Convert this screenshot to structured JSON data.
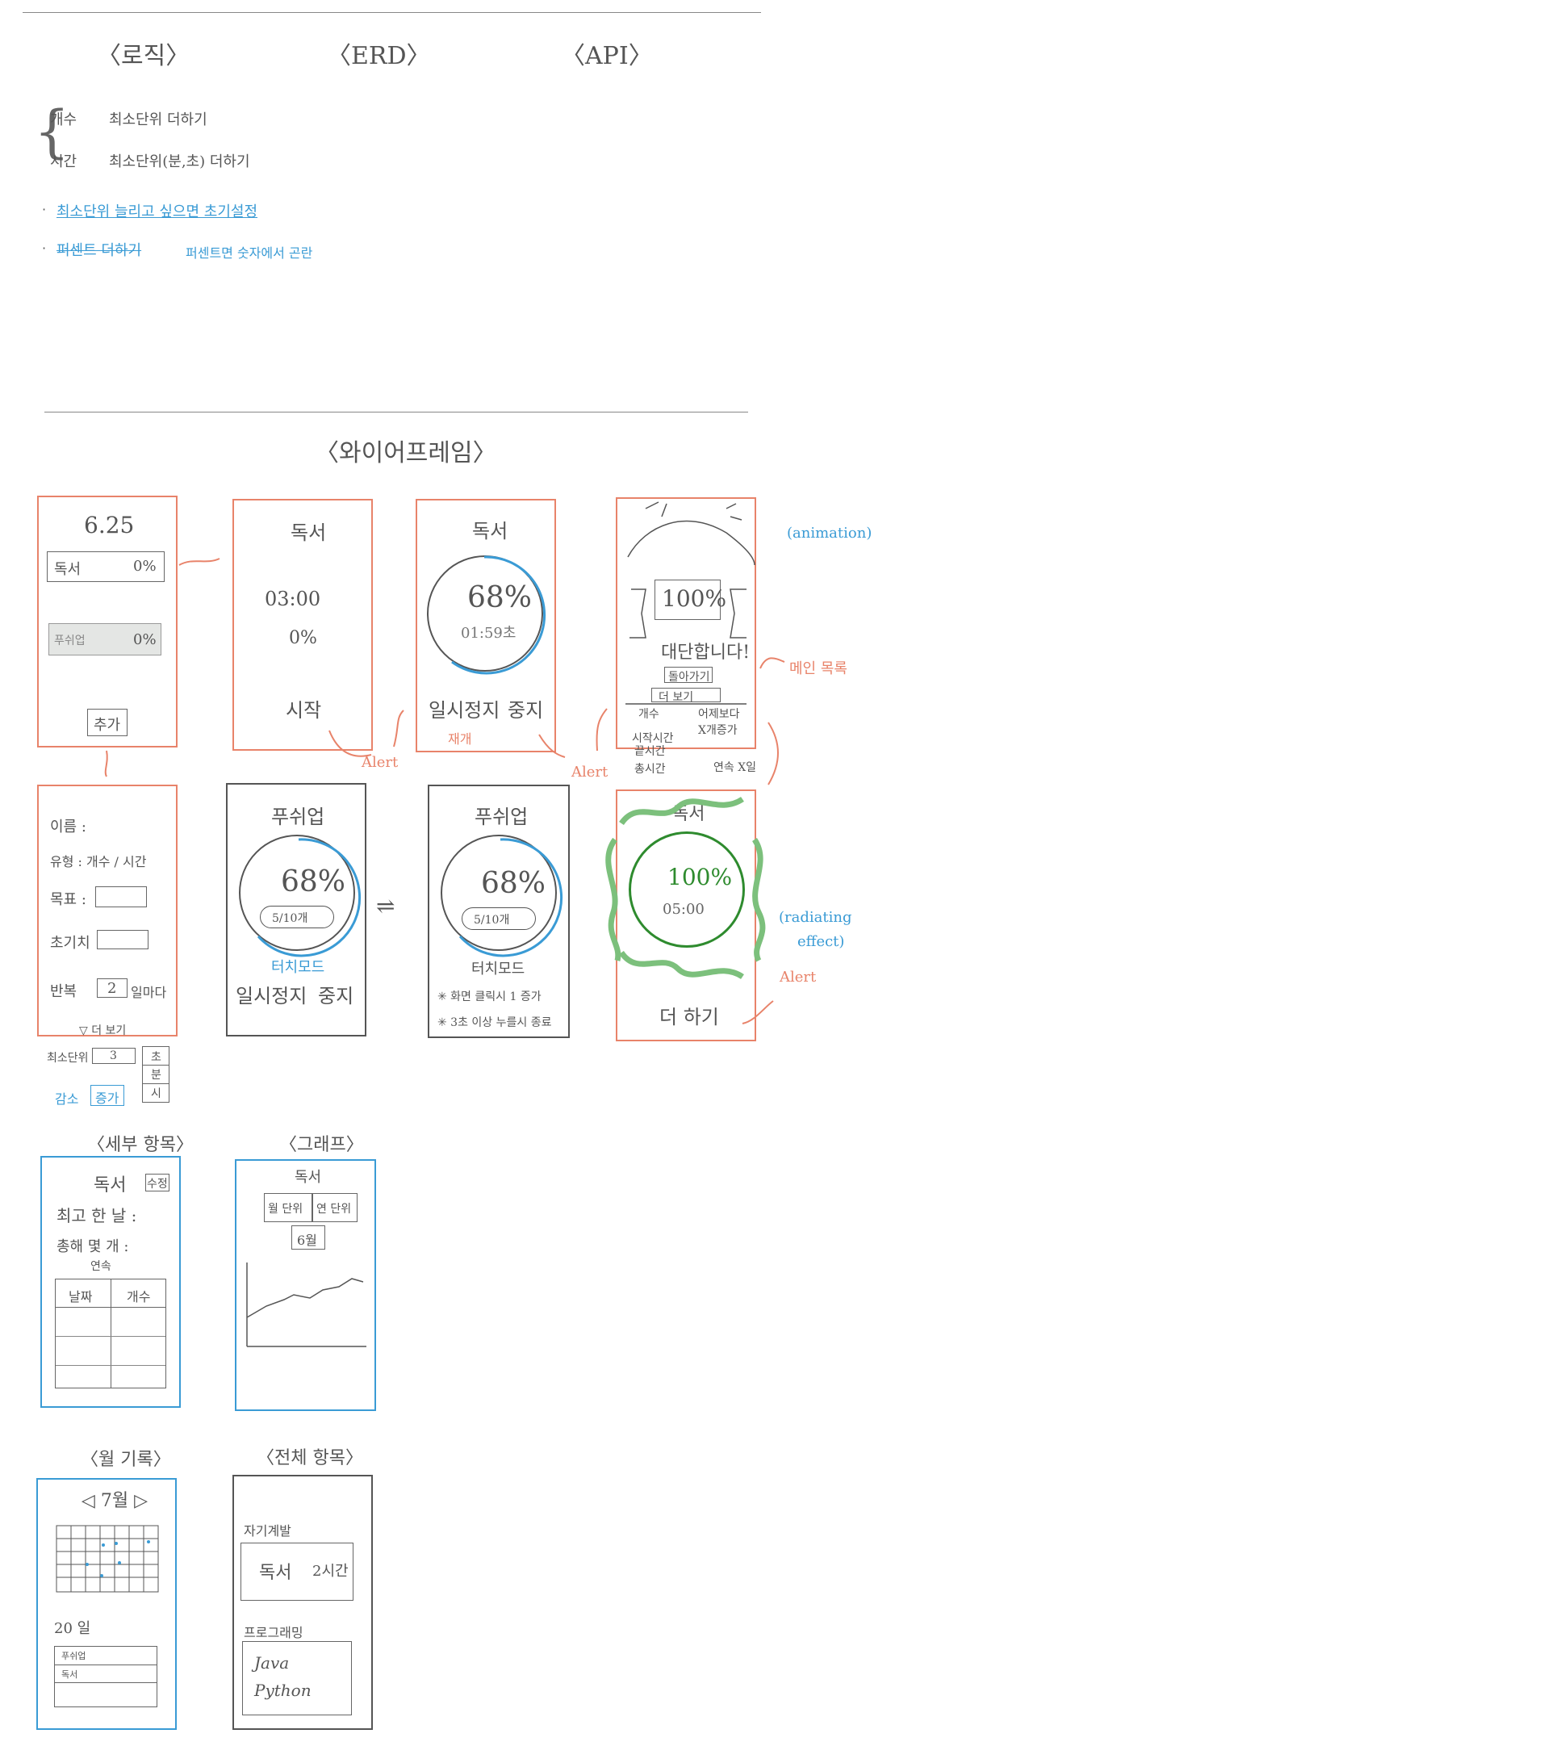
{
  "top": {
    "sections": [
      "〈로직〉",
      "〈ERD〉",
      "〈API〉"
    ],
    "logic": {
      "count_label": "개수",
      "count_desc": "최소단위 더하기",
      "time_label": "시간",
      "time_desc": "최소단위(분,초) 더하기",
      "note1": "최소단위 늘리고 싶으면 초기설정",
      "note2_strike": "퍼센트 더하기",
      "note2": "퍼센트면 숫자에서 곤란"
    }
  },
  "wireframe_title": "〈와이어프레임〉",
  "screen_main": {
    "date": "6.25",
    "items": [
      {
        "name": "독서",
        "pct": "0%"
      },
      {
        "name": "푸쉬업",
        "pct": "0%"
      }
    ],
    "add": "추가"
  },
  "screen_timer_start": {
    "title": "독서",
    "time": "03:00",
    "pct": "0%",
    "start": "시작"
  },
  "screen_timer_run": {
    "title": "독서",
    "pct": "68%",
    "time": "01:59초",
    "pause": "일시정지",
    "stop": "중지",
    "resume": "재개"
  },
  "screen_done": {
    "pct": "100%",
    "congrats": "대단합니다!",
    "back": "돌아가기",
    "more": "더 보기",
    "stats": [
      "개수",
      "시작시간",
      "끝시간",
      "총시간"
    ],
    "compare": "어제보다 X개증가",
    "streak": "연속 X일",
    "animation": "(animation)",
    "main_list": "메인 목록"
  },
  "alerts": [
    "Alert",
    "Alert",
    "Alert"
  ],
  "screen_add": {
    "name": "이름 :",
    "type": "유형 : 개수 / 시간",
    "goal": "목표 :",
    "init": "초기치",
    "repeat": "반복",
    "repeat_val": "2",
    "repeat_unit": "일마다",
    "more": "▽ 더 보기",
    "min_unit": "최소단위",
    "min_unit_val": "3",
    "units": [
      "초",
      "분",
      "시"
    ],
    "dec": "감소",
    "inc": "증가"
  },
  "screen_push1": {
    "title": "푸쉬업",
    "pct": "68%",
    "count": "5/10개",
    "touch": "터치모드",
    "pause": "일시정지",
    "stop": "중지"
  },
  "screen_push2": {
    "title": "푸쉬업",
    "pct": "68%",
    "count": "5/10개",
    "touch": "터치모드",
    "rule1": "✳ 화면 클릭시 1 증가",
    "rule2": "✳ 3초 이상 누를시 종료"
  },
  "screen_done_timer": {
    "title": "독서",
    "pct": "100%",
    "time": "05:00",
    "more": "더 하기",
    "effect1": "(radiating",
    "effect2": "effect)"
  },
  "detail": {
    "section": "〈세부 항목〉",
    "title": "독서",
    "edit": "수정",
    "max_day": "최고 한 날 :",
    "total": "총해 몇 개 :",
    "streak": "연속",
    "cols": [
      "날짜",
      "개수"
    ]
  },
  "graph": {
    "section": "〈그래프〉",
    "title": "독서",
    "tabs": [
      "월 단위",
      "연 단위"
    ],
    "month": "6월"
  },
  "monthly": {
    "section": "〈월 기록〉",
    "month": "◁ 7월 ▷",
    "day": "20 일",
    "rows": [
      "푸쉬업",
      "독서"
    ]
  },
  "all": {
    "section": "〈전체 항목〉",
    "group1": "자기계발",
    "item1": "독서",
    "item1_val": "2시간",
    "group2": "프로그래밍",
    "langs": [
      "Java",
      "Python"
    ]
  }
}
